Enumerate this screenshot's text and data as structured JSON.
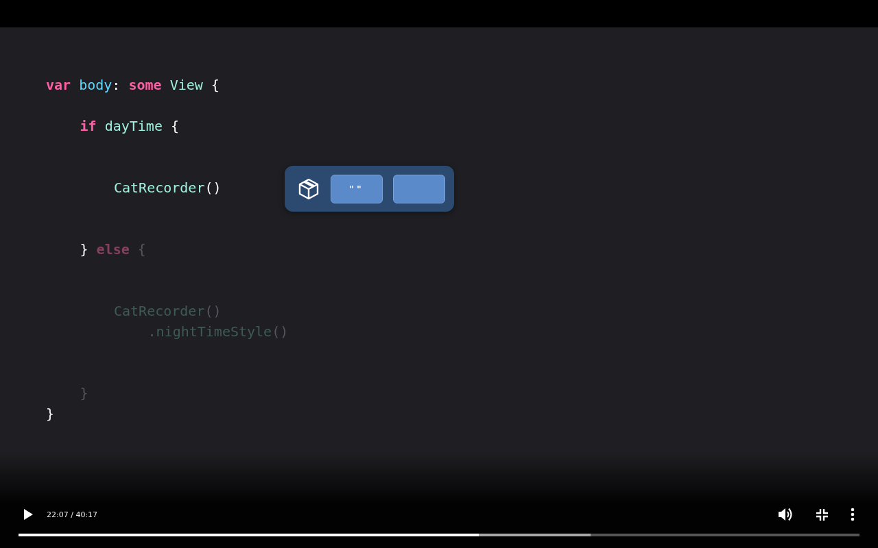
{
  "code": [
    {
      "tokens": [
        {
          "text": "var",
          "kind": "keyword",
          "dimmed": false
        },
        {
          "text": " body",
          "kind": "name",
          "dimmed": false
        },
        {
          "text": ": ",
          "kind": "punct",
          "dimmed": false
        },
        {
          "text": "some",
          "kind": "keyword",
          "dimmed": false
        },
        {
          "text": " View ",
          "kind": "type",
          "dimmed": false
        },
        {
          "text": "{",
          "kind": "punct",
          "dimmed": false
        }
      ],
      "children": [
        {
          "tokens": [
            {
              "text": "if",
              "kind": "keyword",
              "dimmed": false
            },
            {
              "text": " dayTime ",
              "kind": "type",
              "dimmed": false
            },
            {
              "text": "{",
              "kind": "punct",
              "dimmed": false
            }
          ],
          "children": [
            {
              "tokens": [
                {
                  "text": "CatRecorder",
                  "kind": "type",
                  "dimmed": false
                },
                {
                  "text": "()",
                  "kind": "punct",
                  "dimmed": false
                }
              ]
            }
          ]
        },
        {
          "tokens": [
            {
              "text": "} ",
              "kind": "punct",
              "dimmed": false
            },
            {
              "text": "else",
              "kind": "keyword",
              "dimmed": true
            },
            {
              "text": " {",
              "kind": "punct",
              "dimmed": true
            }
          ],
          "children": [
            {
              "tokens": [
                {
                  "text": "CatRecorder",
                  "kind": "type",
                  "dimmed": true
                },
                {
                  "text": "()",
                  "kind": "punct",
                  "dimmed": true
                }
              ],
              "children": [
                {
                  "tokens": [
                    {
                      "text": ".",
                      "kind": "punct",
                      "dimmed": true
                    },
                    {
                      "text": "nightTimeStyle",
                      "kind": "type",
                      "dimmed": true
                    },
                    {
                      "text": "()",
                      "kind": "punct",
                      "dimmed": true
                    }
                  ]
                }
              ]
            }
          ]
        },
        {
          "tokens": [
            {
              "text": "}",
              "kind": "punct",
              "dimmed": true
            }
          ]
        }
      ]
    },
    {
      "tokens": [
        {
          "text": "}",
          "kind": "punct",
          "dimmed": false
        }
      ]
    }
  ],
  "popover": {
    "buttons": [
      {
        "kind": "text",
        "label": "\"\""
      },
      {
        "kind": "blank"
      }
    ]
  },
  "player": {
    "playing": false,
    "time": "22:07 / 40:17",
    "progress": {
      "level": 0.547
    },
    "buffered": {
      "level": 0.68
    },
    "muted": false,
    "fullscreen": true
  }
}
